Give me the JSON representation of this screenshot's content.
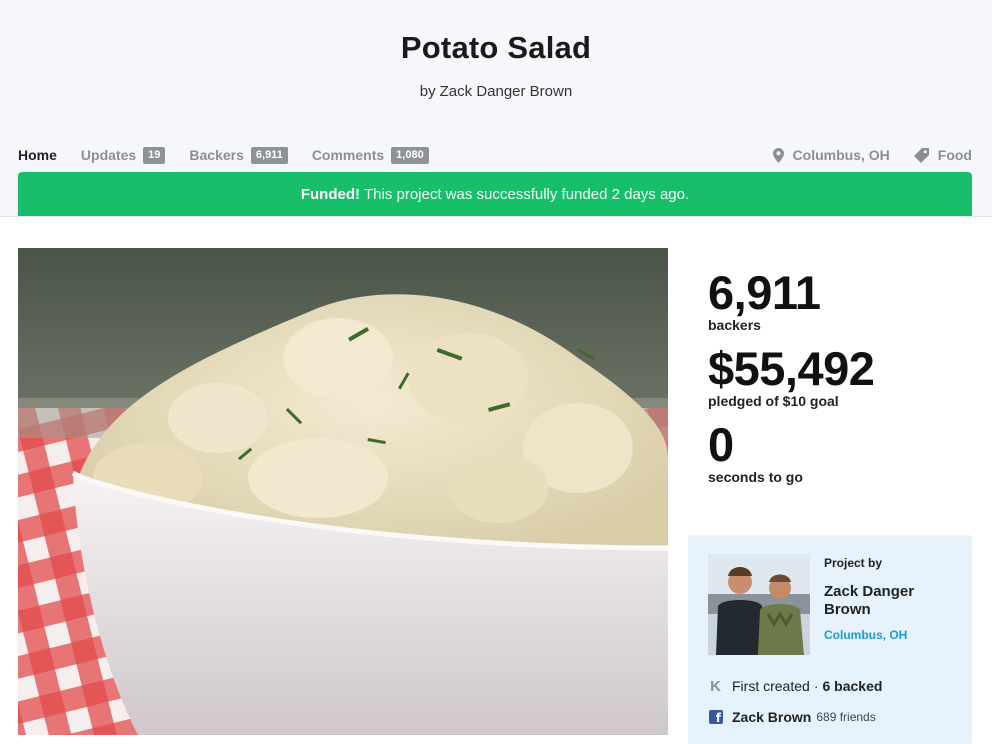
{
  "project": {
    "title": "Potato Salad",
    "by_prefix": "by",
    "creator": "Zack Danger Brown"
  },
  "nav": {
    "tabs": [
      {
        "label": "Home",
        "active": true
      },
      {
        "label": "Updates",
        "count": "19"
      },
      {
        "label": "Backers",
        "count": "6,911"
      },
      {
        "label": "Comments",
        "count": "1,080"
      }
    ],
    "location": {
      "label": "Columbus, OH",
      "icon": "map-pin-icon"
    },
    "category": {
      "label": "Food",
      "icon": "tag-icon"
    }
  },
  "banner": {
    "strong": "Funded!",
    "text": "This project was successfully funded 2 days ago.",
    "color": "#17bf6b"
  },
  "stats": [
    {
      "value": "6,911",
      "label": "backers"
    },
    {
      "value": "$55,492",
      "label": "pledged of $10 goal"
    },
    {
      "value": "0",
      "label": "seconds to go"
    }
  ],
  "creator_card": {
    "heading": "Project by",
    "name": "Zack Danger Brown",
    "location": "Columbus, OH",
    "first_created": "First created",
    "separator": "·",
    "backed": "6 backed",
    "facebook_name": "Zack Brown",
    "facebook_friends": "689 friends",
    "link_color": "#1a9bd7",
    "card_color": "#e6f3fd"
  }
}
